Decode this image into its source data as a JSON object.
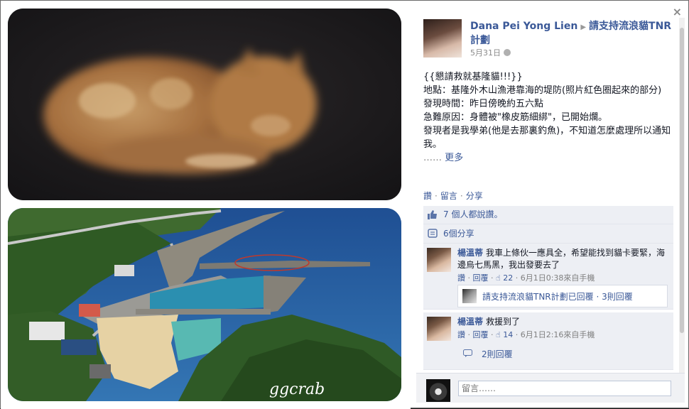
{
  "close_label": "×",
  "post": {
    "author": "Dana Pei Yong Lien",
    "page_name": "請支持流浪貓TNR計劃",
    "date": "5月31日",
    "body_lines": [
      "{{懇請救就基隆貓!!!}}",
      "地點：基隆外木山漁港靠海的堤防(照片紅色圈起來的部分)",
      "發現時間：昨日傍晚約五六點",
      "急難原因：身體被\"橡皮筋細綁\"，已開始爛。",
      "發現者是我學弟(他是去那裏釣魚)，不知道怎麼處理所以通知我。"
    ],
    "ellipsis": "……",
    "more_label": "更多"
  },
  "actions": {
    "like": "讚",
    "comment": "留言",
    "share": "分享"
  },
  "likes_text": "7 個人都說讚。",
  "shares_text": "6個分享",
  "comments": [
    {
      "name": "楊溫蒂",
      "text": "我車上條伙一應具全，希望能找到貓卡要緊，海邊烏七馬黑，我出發要去了",
      "like": "讚",
      "reply": "回覆",
      "likes": "22",
      "time": "6月1日0:38來自手機",
      "reply_thread": "請支持流浪貓TNR計劃已回覆 · 3則回覆"
    },
    {
      "name": "楊溫蒂",
      "text": "救援到了",
      "like": "讚",
      "reply": "回覆",
      "likes": "14",
      "time": "6月1日2:16來自手機",
      "reply_count": "2則回覆"
    }
  ],
  "composer": {
    "placeholder": "留言……"
  },
  "watermark": "ggcrab"
}
